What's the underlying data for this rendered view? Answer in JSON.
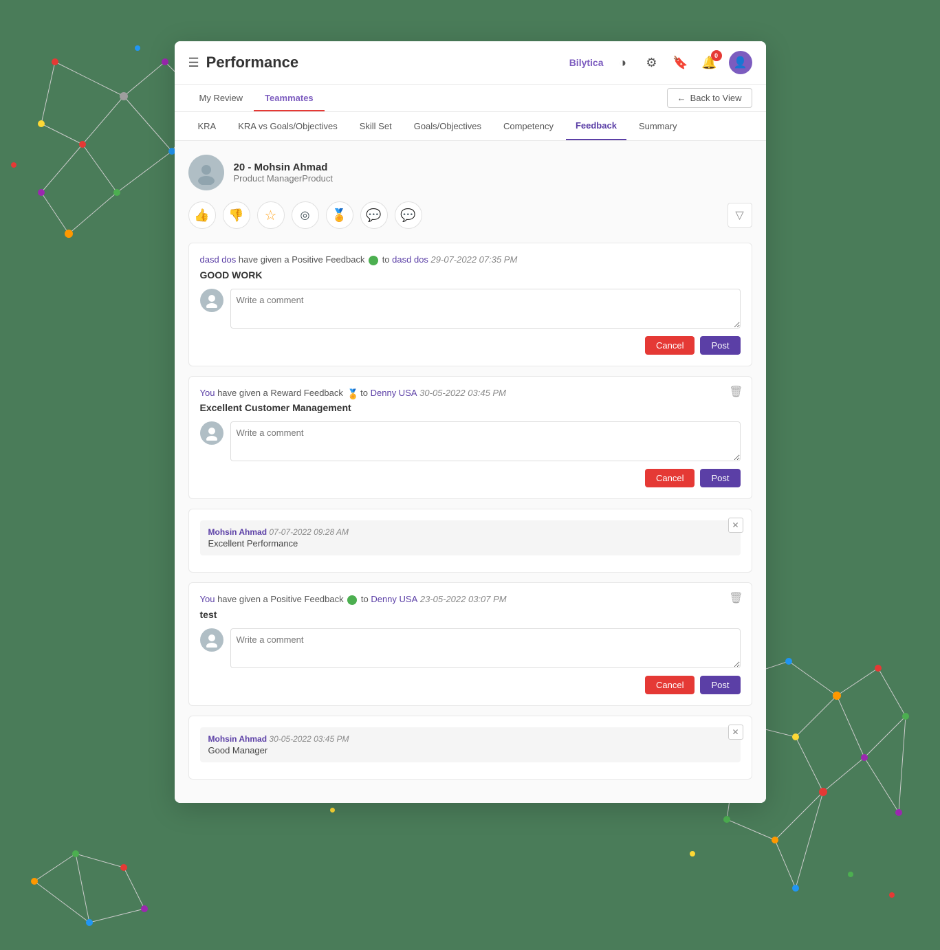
{
  "header": {
    "menu_icon": "☰",
    "title": "Performance",
    "brand": "Bilytica",
    "icons": {
      "chart": "◑",
      "settings": "⚙",
      "bookmark": "🔖",
      "notification": "🔔",
      "notif_count": "0"
    }
  },
  "sub_nav": {
    "items": [
      {
        "label": "My Review",
        "active": false
      },
      {
        "label": "Teammates",
        "active": true
      }
    ],
    "back_btn": "Back to View"
  },
  "tabs": [
    {
      "label": "KRA",
      "active": false
    },
    {
      "label": "KRA vs Goals/Objectives",
      "active": false
    },
    {
      "label": "Skill Set",
      "active": false
    },
    {
      "label": "Goals/Objectives",
      "active": false
    },
    {
      "label": "Competency",
      "active": false
    },
    {
      "label": "Feedback",
      "active": true
    },
    {
      "label": "Summary",
      "active": false
    }
  ],
  "employee": {
    "id": "20",
    "name": "Mohsin Ahmad",
    "role": "Product ManagerProduct"
  },
  "filter_icons": [
    {
      "key": "thumbs-up",
      "symbol": "👍",
      "class": "thumbs-up"
    },
    {
      "key": "thumbs-down",
      "symbol": "👎",
      "class": "thumbs-down"
    },
    {
      "key": "star",
      "symbol": "☆",
      "class": "star"
    },
    {
      "key": "eye",
      "symbol": "◎",
      "class": "eye"
    },
    {
      "key": "reward",
      "symbol": "🏅",
      "class": "reward"
    },
    {
      "key": "chat1",
      "symbol": "💬",
      "class": "chat1"
    },
    {
      "key": "chat2",
      "symbol": "💬",
      "class": "chat2"
    }
  ],
  "feedbacks": [
    {
      "id": "fb1",
      "sender": "dasd dos",
      "action": "have given a Positive Feedback",
      "dot_type": "positive",
      "connector": "to",
      "receiver": "dasd dos",
      "timestamp": "29-07-2022 07:35 PM",
      "text": "GOOD WORK",
      "has_trash": false,
      "has_close": false,
      "comment_placeholder": "Write a comment",
      "sub_comments": []
    },
    {
      "id": "fb2",
      "sender": "You",
      "action": "have given a Reward Feedback",
      "dot_type": "reward",
      "dot_symbol": "🏅",
      "connector": "to",
      "receiver": "Denny USA",
      "timestamp": "30-05-2022 03:45 PM",
      "text": "Excellent Customer Management",
      "has_trash": true,
      "has_close": false,
      "comment_placeholder": "Write a comment",
      "sub_comments": []
    },
    {
      "id": "fb3",
      "sender": "Mohsin Ahmad",
      "action": "",
      "dot_type": "",
      "connector": "",
      "receiver": "",
      "timestamp": "07-07-2022 09:28 AM",
      "text": "Excellent Performance",
      "has_trash": false,
      "has_close": true,
      "comment_placeholder": "",
      "sub_comments": [],
      "type": "comment_only"
    },
    {
      "id": "fb4",
      "sender": "You",
      "action": "have given a Positive Feedback",
      "dot_type": "positive",
      "connector": "to",
      "receiver": "Denny USA",
      "timestamp": "23-05-2022 03:07 PM",
      "text": "test",
      "has_trash": true,
      "has_close": false,
      "comment_placeholder": "Write a comment",
      "sub_comments": []
    },
    {
      "id": "fb5",
      "sender": "Mohsin Ahmad",
      "action": "",
      "dot_type": "",
      "connector": "",
      "receiver": "",
      "timestamp": "30-05-2022 03:45 PM",
      "text": "Good Manager",
      "has_trash": false,
      "has_close": true,
      "comment_placeholder": "",
      "sub_comments": [],
      "type": "comment_only"
    }
  ],
  "buttons": {
    "cancel": "Cancel",
    "post": "Post",
    "back": "Back to View"
  }
}
